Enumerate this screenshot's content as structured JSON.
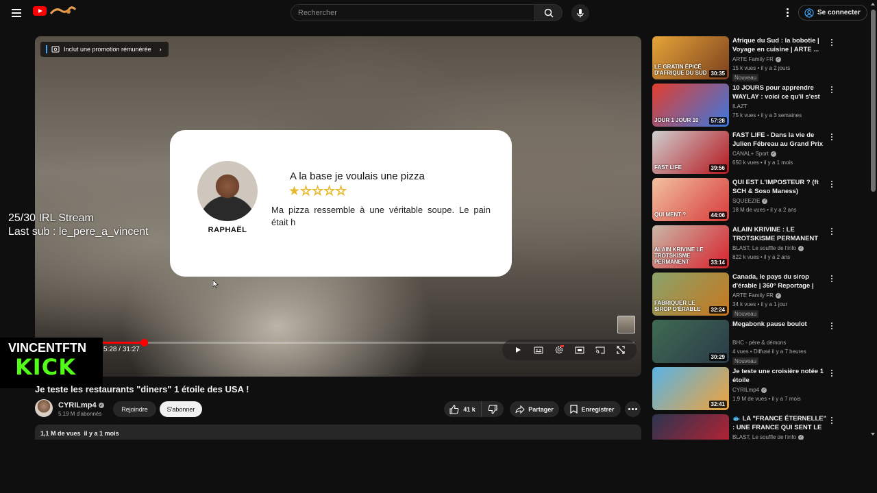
{
  "header": {
    "search_placeholder": "Rechercher",
    "signin_label": "Se connecter"
  },
  "player": {
    "promo_label": "Inclut une promotion rémunérée",
    "time_current": "5:28",
    "time_sep": " / ",
    "time_total": "31:27",
    "progress_fraction": 0.078,
    "review": {
      "name": "RAPHAËL",
      "title": "A la base je voulais une pizza",
      "stars_on": "★",
      "stars_off": "☆☆☆☆",
      "rating": 1,
      "text": "Ma pizza ressemble à une véritable soupe. Le pain était h"
    }
  },
  "overlay": {
    "stream_line1": "25/30 IRL Stream",
    "stream_line2": "Last sub : le_pere_a_vincent",
    "kick_name": "VINCENTFTN",
    "kick_logo": "KICK",
    "kick_color": "#53fc18"
  },
  "video": {
    "title": "Je teste les restaurants \"diners\" 1 étoile des USA !",
    "channel": "CYRILmp4",
    "subscribers": "5,19 M d'abonnés",
    "join_label": "Rejoindre",
    "subscribe_label": "S'abonner",
    "likes": "41 k",
    "share_label": "Partager",
    "save_label": "Enregistrer",
    "views": "1,1 M de vues",
    "date": "il y a 1 mois"
  },
  "sidebar": {
    "items": [
      {
        "title": "Afrique du Sud : la bobotie | Voyage en cuisine | ARTE ...",
        "channel": "ARTE Family FR",
        "verified": true,
        "meta": "15 k vues • il y a 2 jours",
        "badge": "Nouveau",
        "duration": "30:35",
        "thumb": "LE GRATIN ÉPICÉ D'AFRIQUE DU SUD",
        "colors": [
          "#e6a53a",
          "#7a3f1c"
        ]
      },
      {
        "title": "10 JOURS pour apprendre WAYLAY : voici ce qu'il s'est ...",
        "channel": "ILAZT",
        "verified": false,
        "meta": "75 k vues • il y a 3 semaines",
        "badge": "",
        "duration": "57:28",
        "thumb": "JOUR 1 JOUR 10",
        "colors": [
          "#e33e2d",
          "#3a78e0"
        ]
      },
      {
        "title": "FAST LIFE - Dans la vie de Julien Fébreau au Grand Prix d...",
        "channel": "CANAL+ Sport",
        "verified": true,
        "meta": "650 k vues • il y a 1 mois",
        "badge": "",
        "duration": "39:56",
        "thumb": "FAST LIFE",
        "colors": [
          "#cfcfcf",
          "#b4161d"
        ]
      },
      {
        "title": "QUI EST L'IMPOSTEUR ? (ft SCH & Soso Maness)",
        "channel": "SQUEEZIE",
        "verified": true,
        "meta": "18 M de vues • il y a 2 ans",
        "badge": "",
        "duration": "44:06",
        "thumb": "QUI MENT ?",
        "colors": [
          "#f2c1a0",
          "#d63a3a"
        ]
      },
      {
        "title": "ALAIN KRIVINE : LE TROTSKISME PERMANENT",
        "channel": "BLAST, Le souffle de l'info",
        "verified": true,
        "meta": "822 k vues • il y a 2 ans",
        "badge": "",
        "duration": "33:14",
        "thumb": "ALAIN KRIVINE LE TROTSKISME PERMANENT",
        "colors": [
          "#c9b8a8",
          "#d8202a"
        ]
      },
      {
        "title": "Canada, le pays du sirop d'érable | 360° Reportage | AR...",
        "channel": "ARTE Family FR",
        "verified": true,
        "meta": "34 k vues • il y a 1 jour",
        "badge": "Nouveau",
        "duration": "32:24",
        "thumb": "FABRIQUER LE SIROP D'ÉRABLE",
        "colors": [
          "#8aa36c",
          "#c7771d"
        ]
      },
      {
        "title": "Megabonk pause boulot",
        "channel": "BHC - père & démons",
        "verified": false,
        "meta": "4 vues • Diffusé il y a 7 heures",
        "badge": "Nouveau",
        "duration": "30:29",
        "thumb": "",
        "colors": [
          "#3f6b52",
          "#2a3a48"
        ]
      },
      {
        "title": "Je teste une croisière notée 1 étoile",
        "channel": "CYRILmp4",
        "verified": true,
        "meta": "1,9 M de vues • il y a 7 mois",
        "badge": "",
        "duration": "32:41",
        "thumb": "",
        "colors": [
          "#59b3e6",
          "#f0a23a"
        ]
      },
      {
        "title": "🐟 LA \"FRANCE ÉTERNELLE\" : UNE FRANCE QUI SENT LE ...",
        "channel": "BLAST, Le souffle de l'info",
        "verified": true,
        "meta": "",
        "badge": "",
        "duration": "",
        "thumb": "",
        "colors": [
          "#2b3550",
          "#c82030"
        ]
      }
    ]
  }
}
